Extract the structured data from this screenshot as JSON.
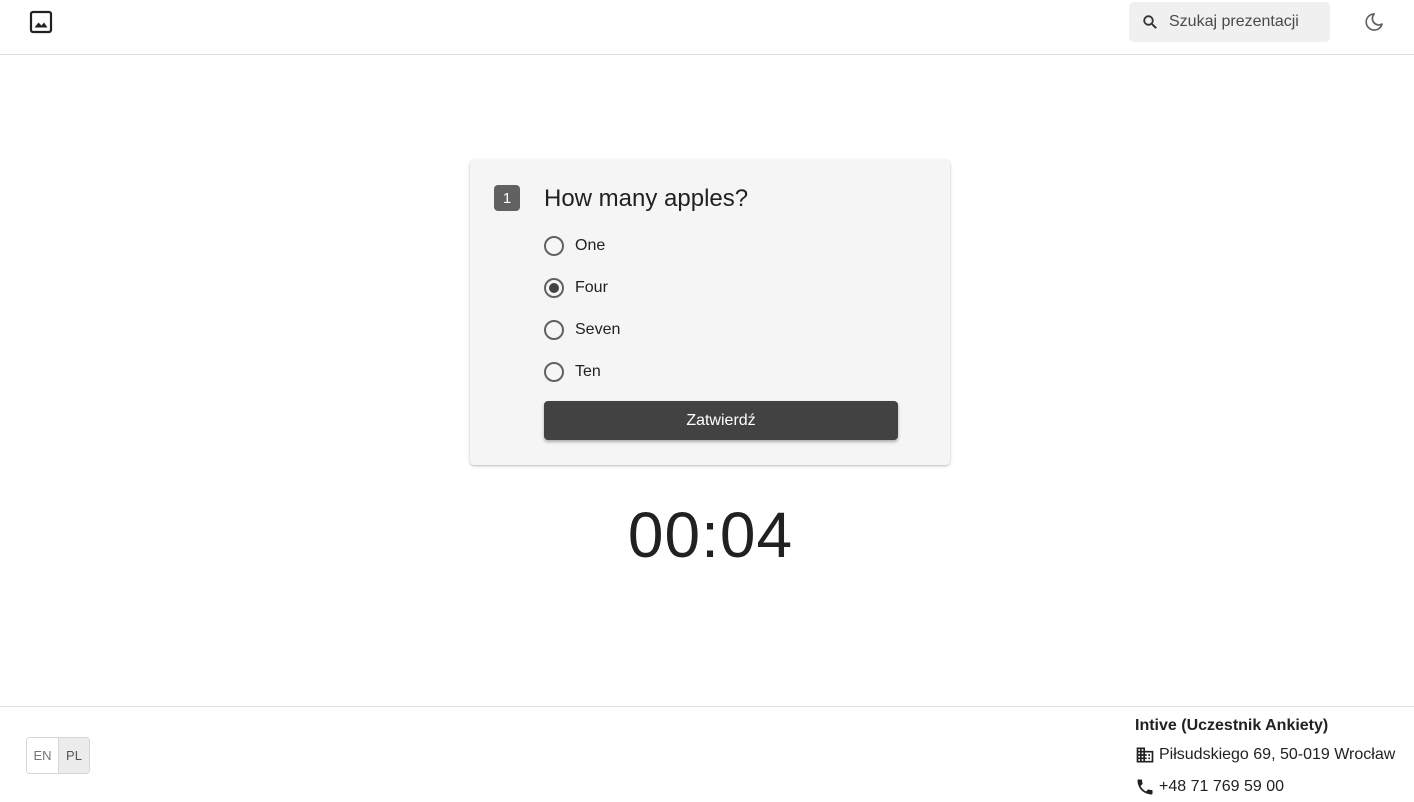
{
  "header": {
    "logo_icon": "image-icon",
    "search": {
      "placeholder": "Szukaj prezentacji",
      "value": ""
    },
    "theme_icon": "moon-icon"
  },
  "question": {
    "number": "1",
    "title": "How many apples?",
    "options": [
      {
        "label": "One",
        "selected": false
      },
      {
        "label": "Four",
        "selected": true
      },
      {
        "label": "Seven",
        "selected": false
      },
      {
        "label": "Ten",
        "selected": false
      }
    ],
    "submit_label": "Zatwierdź"
  },
  "timer": "00:04",
  "footer": {
    "languages": [
      {
        "label": "EN",
        "active": false
      },
      {
        "label": "PL",
        "active": true
      }
    ],
    "company": "Intive (Uczestnik Ankiety)",
    "address": "Piłsudskiego 69, 50-019 Wrocław",
    "phone": "+48 71 769 59 00"
  },
  "colors": {
    "primary": "#424242",
    "surface": "#f5f5f5",
    "badge": "#616161"
  }
}
